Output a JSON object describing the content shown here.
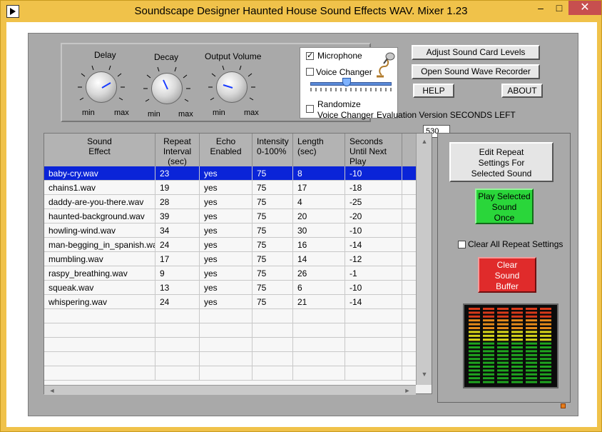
{
  "window": {
    "title": "Soundscape Designer Haunted House Sound Effects WAV. Mixer 1.23",
    "minimize": "‒",
    "maximize": "□",
    "close": "✕"
  },
  "knobs": {
    "delay": {
      "label": "Delay",
      "min": "min",
      "max": "max"
    },
    "decay": {
      "label": "Decay",
      "min": "min",
      "max": "max"
    },
    "output": {
      "label": "Output Volume",
      "min": "min",
      "max": "max"
    }
  },
  "voice": {
    "microphone_label": "Microphone",
    "microphone_checked": "✓",
    "voice_changer_label": "Voice Changer",
    "randomize_label_1": "Randomize",
    "randomize_label_2": "Voice Changer",
    "slider_value": 0.45
  },
  "buttons": {
    "adjust": "Adjust Sound Card Levels",
    "wave": "Open Sound Wave Recorder",
    "help": "HELP",
    "about": "ABOUT",
    "edit_1": "Edit  Repeat",
    "edit_2": "Settings For",
    "edit_3": "Selected Sound",
    "play_1": "Play Selected",
    "play_2": "Sound",
    "play_3": "Once",
    "buffer_1": "Clear",
    "buffer_2": "Sound",
    "buffer_3": "Buffer",
    "clear_all": "Clear All Repeat Settings"
  },
  "evaluation": {
    "label": "Evaluation Version  SECONDS  LEFT",
    "seconds": "530"
  },
  "table": {
    "headers": [
      {
        "l1": "Sound",
        "l2": "Effect",
        "l3": ""
      },
      {
        "l1": "Repeat",
        "l2": "Interval",
        "l3": "(sec)"
      },
      {
        "l1": "Echo",
        "l2": "Enabled",
        "l3": ""
      },
      {
        "l1": "Intensity",
        "l2": "0-100%",
        "l3": ""
      },
      {
        "l1": "Length",
        "l2": "(sec)",
        "l3": ""
      },
      {
        "l1": "Seconds",
        "l2": "Until Next",
        "l3": "Play"
      }
    ],
    "rows": [
      {
        "name": "baby-cry.wav",
        "repeat": "23",
        "echo": "yes",
        "intensity": "75",
        "length": "8",
        "until": "-10"
      },
      {
        "name": "chains1.wav",
        "repeat": "19",
        "echo": "yes",
        "intensity": "75",
        "length": "17",
        "until": "-18"
      },
      {
        "name": "daddy-are-you-there.wav",
        "repeat": "28",
        "echo": "yes",
        "intensity": "75",
        "length": "4",
        "until": "-25"
      },
      {
        "name": "haunted-background.wav",
        "repeat": "39",
        "echo": "yes",
        "intensity": "75",
        "length": "20",
        "until": "-20"
      },
      {
        "name": "howling-wind.wav",
        "repeat": "34",
        "echo": "yes",
        "intensity": "75",
        "length": "30",
        "until": "-10"
      },
      {
        "name": "man-begging_in_spanish.wav",
        "repeat": "24",
        "echo": "yes",
        "intensity": "75",
        "length": "16",
        "until": "-14"
      },
      {
        "name": "mumbling.wav",
        "repeat": "17",
        "echo": "yes",
        "intensity": "75",
        "length": "14",
        "until": "-12"
      },
      {
        "name": "raspy_breathing.wav",
        "repeat": "9",
        "echo": "yes",
        "intensity": "75",
        "length": "26",
        "until": "-1"
      },
      {
        "name": "squeak.wav",
        "repeat": "13",
        "echo": "yes",
        "intensity": "75",
        "length": "6",
        "until": "-10"
      },
      {
        "name": "whispering.wav",
        "repeat": "24",
        "echo": "yes",
        "intensity": "75",
        "length": "21",
        "until": "-14"
      }
    ],
    "selected_row": 0
  },
  "colors": {
    "selection": "#0a24d8",
    "play_button": "#2ad63a",
    "clear_buffer_button": "#e02b2b",
    "title_bar": "#f0c24a"
  },
  "icons": {
    "app": "labview-run-icon",
    "mic": "microphone-icon"
  }
}
